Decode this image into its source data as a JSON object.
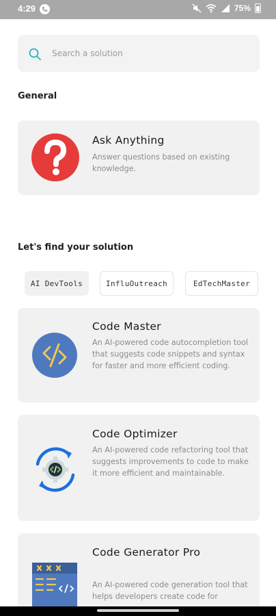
{
  "status_bar": {
    "time": "4:29",
    "battery": "75%",
    "icons": [
      "phone-icon",
      "mute-icon",
      "wifi-icon",
      "signal-icon",
      "battery-icon"
    ]
  },
  "search": {
    "placeholder": "Search a solution",
    "value": ""
  },
  "general": {
    "heading": "General",
    "card": {
      "title": "Ask Anything",
      "description": "Answer questions based on existing knowledge.",
      "icon": "question-icon"
    }
  },
  "solutions": {
    "heading": "Let's find your solution",
    "chips": [
      {
        "label": "AI DevTools",
        "selected": true
      },
      {
        "label": "InfluOutreach",
        "selected": false
      },
      {
        "label": "EdTechMaster",
        "selected": false
      }
    ],
    "cards": [
      {
        "title": "Code Master",
        "description": "An AI-powered code autocompletion tool that suggests code snippets and syntax for faster and more efficient coding.",
        "icon": "code-slash-icon"
      },
      {
        "title": "Code Optimizer",
        "description": "An AI-powered code refactoring tool that suggests improvements to code to make it more efficient and maintainable.",
        "icon": "code-refresh-icon"
      },
      {
        "title": "Code Generator Pro",
        "description": "An AI-powered code generation tool that helps developers create code for",
        "icon": "code-generator-icon"
      }
    ]
  },
  "colors": {
    "accent": "#e63b3b",
    "search_icon": "#27b5c4",
    "card_bg": "#f1f1f1"
  }
}
